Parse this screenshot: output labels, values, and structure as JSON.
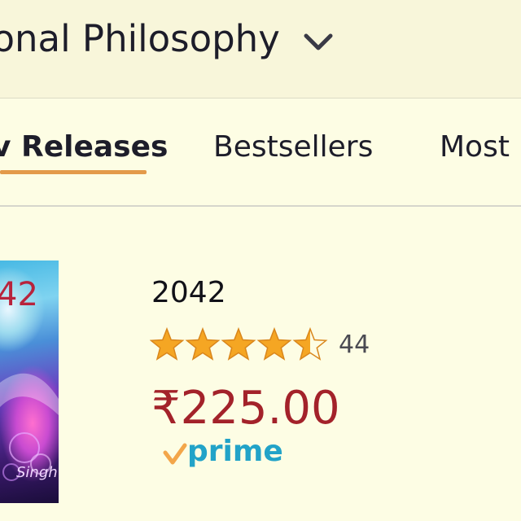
{
  "header": {
    "category_title": "ional Philosophy"
  },
  "tabs": [
    {
      "label": "v Releases",
      "selected": true
    },
    {
      "label": "Bestsellers",
      "selected": false
    },
    {
      "label": "Most",
      "selected": false
    }
  ],
  "product": {
    "cover_title": "42",
    "cover_author": "Singh",
    "title": "2042",
    "rating": 4.5,
    "rating_max": 5,
    "rating_count": "44",
    "price": "₹225.00",
    "prime_label": "prime"
  },
  "colors": {
    "accent_underline": "#e39a4a",
    "star_fill": "#f5a623",
    "price": "#a3222a",
    "prime_text": "#22a3c8",
    "prime_check": "#f3a64a"
  }
}
